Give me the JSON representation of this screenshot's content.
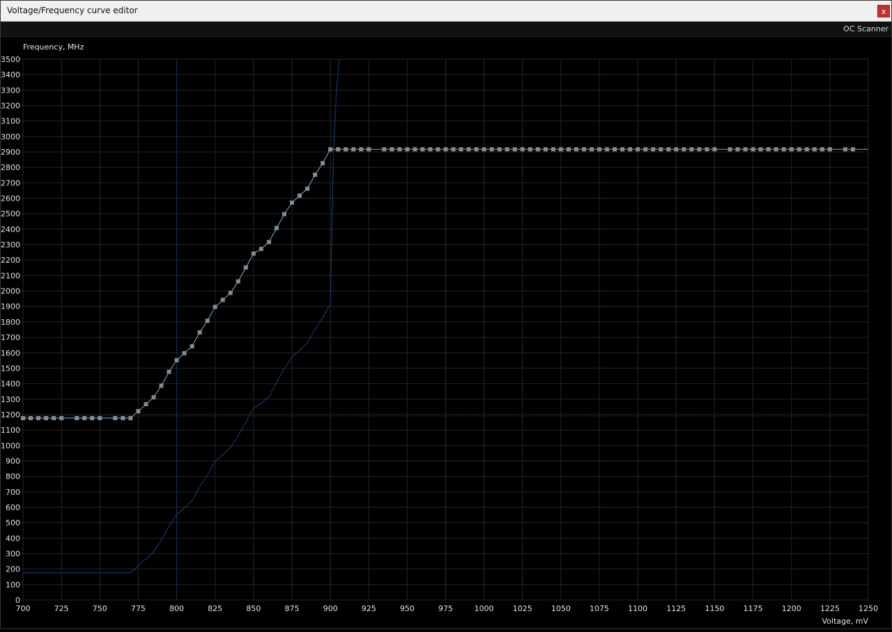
{
  "window": {
    "title": "Voltage/Frequency curve editor",
    "close_label": "x"
  },
  "toolbar": {
    "oc_scanner_label": "OC Scanner"
  },
  "chart_data": {
    "type": "line",
    "ylabel": "Frequency, MHz",
    "xlabel": "Voltage, mV",
    "xlim": [
      700,
      1250
    ],
    "ylim": [
      0,
      3500
    ],
    "x_ticks": [
      700,
      725,
      750,
      775,
      800,
      825,
      850,
      875,
      900,
      925,
      950,
      975,
      1000,
      1025,
      1050,
      1075,
      1100,
      1125,
      1150,
      1175,
      1200,
      1225,
      1250
    ],
    "y_ticks": [
      0,
      100,
      200,
      300,
      400,
      500,
      600,
      700,
      800,
      900,
      1000,
      1100,
      1200,
      1300,
      1400,
      1500,
      1600,
      1700,
      1800,
      1900,
      2000,
      2100,
      2200,
      2300,
      2400,
      2500,
      2600,
      2700,
      2800,
      2900,
      3000,
      3100,
      3200,
      3300,
      3400,
      3500
    ],
    "grid": true,
    "cursor_voltage": 800,
    "reference_frequency": 1190,
    "curve_x": [
      700,
      705,
      710,
      715,
      720,
      725,
      735,
      740,
      745,
      750,
      760,
      765,
      770,
      775,
      780,
      785,
      790,
      795,
      800,
      805,
      810,
      815,
      820,
      825,
      830,
      835,
      840,
      845,
      850,
      855,
      860,
      865,
      870,
      875,
      880,
      885,
      890,
      895,
      900,
      905,
      910,
      915,
      920,
      925,
      935,
      940,
      945,
      950,
      955,
      960,
      965,
      970,
      975,
      980,
      985,
      990,
      995,
      1000,
      1005,
      1010,
      1015,
      1020,
      1025,
      1030,
      1035,
      1040,
      1045,
      1050,
      1055,
      1060,
      1065,
      1070,
      1075,
      1080,
      1085,
      1090,
      1095,
      1100,
      1105,
      1110,
      1115,
      1120,
      1125,
      1130,
      1135,
      1140,
      1145,
      1150,
      1160,
      1165,
      1170,
      1175,
      1180,
      1185,
      1190,
      1195,
      1200,
      1205,
      1210,
      1215,
      1220,
      1225,
      1235,
      1240
    ],
    "curve_y": [
      1177,
      1177,
      1177,
      1177,
      1177,
      1177,
      1177,
      1177,
      1177,
      1177,
      1177,
      1177,
      1177,
      1222,
      1267,
      1312,
      1387,
      1477,
      1552,
      1597,
      1642,
      1732,
      1807,
      1897,
      1942,
      1987,
      2062,
      2152,
      2242,
      2272,
      2317,
      2407,
      2497,
      2572,
      2617,
      2662,
      2752,
      2827,
      2917,
      2917,
      2917,
      2917,
      2917,
      2917,
      2917,
      2917,
      2917,
      2917,
      2917,
      2917,
      2917,
      2917,
      2917,
      2917,
      2917,
      2917,
      2917,
      2917,
      2917,
      2917,
      2917,
      2917,
      2917,
      2917,
      2917,
      2917,
      2917,
      2917,
      2917,
      2917,
      2917,
      2917,
      2917,
      2917,
      2917,
      2917,
      2917,
      2917,
      2917,
      2917,
      2917,
      2917,
      2917,
      2917,
      2917,
      2917,
      2917,
      2917,
      2917,
      2917,
      2917,
      2917,
      2917,
      2917,
      2917,
      2917,
      2917,
      2917,
      2917,
      2917,
      2917,
      2917,
      2917,
      2917
    ],
    "base_curve_x": [
      700,
      770,
      775,
      780,
      785,
      790,
      795,
      800,
      805,
      810,
      815,
      820,
      825,
      830,
      835,
      840,
      845,
      850,
      855,
      860,
      865,
      870,
      875,
      880,
      885,
      890,
      895,
      900,
      902,
      904,
      906
    ],
    "base_curve_y": [
      177,
      177,
      222,
      267,
      312,
      387,
      477,
      552,
      597,
      642,
      732,
      807,
      897,
      942,
      987,
      1062,
      1152,
      1242,
      1272,
      1317,
      1407,
      1497,
      1572,
      1617,
      1662,
      1752,
      1827,
      1917,
      2900,
      3300,
      3500
    ]
  },
  "colors": {
    "curve": "#6ab4ea",
    "point_fill": "#8a8a8a",
    "base_curve": "#14356f",
    "grid": "#262626",
    "cursor": "#123058",
    "axis_text": "#e6e6e6"
  }
}
